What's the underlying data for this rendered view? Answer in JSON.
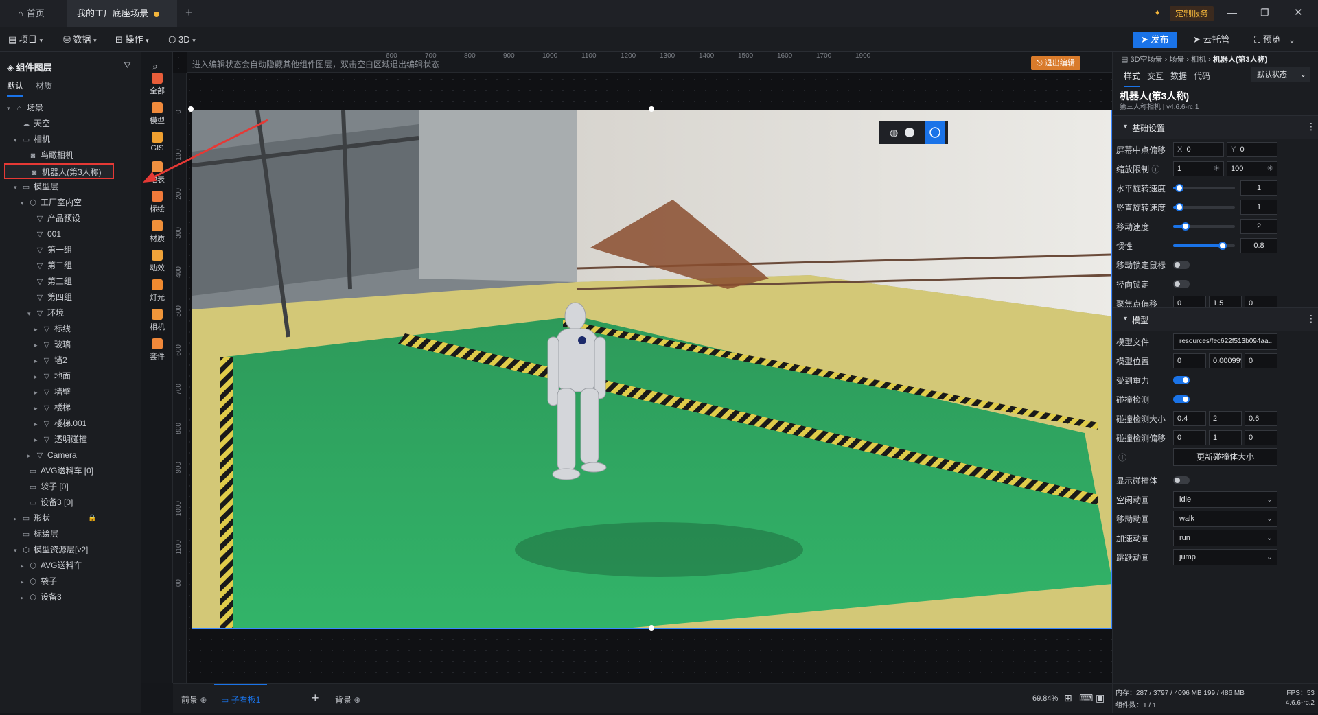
{
  "titlebar": {
    "tabs": [
      {
        "label": "首页"
      },
      {
        "label": "我的工厂底座场景"
      }
    ],
    "new_tab": "+",
    "custom_service": "定制服务"
  },
  "menubar": {
    "items": [
      {
        "label": "项目"
      },
      {
        "label": "数据"
      },
      {
        "label": "操作"
      },
      {
        "label": "3D"
      }
    ],
    "publish": "发布",
    "cloud": "云托管",
    "preview": "预览"
  },
  "left_panel": {
    "title": "组件图层",
    "tabs": [
      "默认",
      "材质"
    ],
    "tree": [
      {
        "label": "场景",
        "level": 0,
        "caret": "▾",
        "icon": "⌂"
      },
      {
        "label": "天空",
        "level": 1,
        "caret": "",
        "icon": "☁"
      },
      {
        "label": "相机",
        "level": 1,
        "caret": "▾",
        "icon": "▭"
      },
      {
        "label": "鸟瞰相机",
        "level": 2,
        "caret": "",
        "icon": "◙"
      },
      {
        "label": "机器人(第3人称)",
        "level": 2,
        "caret": "",
        "icon": "◙"
      },
      {
        "label": "模型层",
        "level": 1,
        "caret": "▾",
        "icon": "▭"
      },
      {
        "label": "工厂室内空",
        "level": 2,
        "caret": "▾",
        "icon": "⬡"
      },
      {
        "label": "产品预设",
        "level": 3,
        "caret": "",
        "icon": "▽"
      },
      {
        "label": "001",
        "level": 3,
        "caret": "",
        "icon": "▽"
      },
      {
        "label": "第一组",
        "level": 3,
        "caret": "",
        "icon": "▽"
      },
      {
        "label": "第二组",
        "level": 3,
        "caret": "",
        "icon": "▽"
      },
      {
        "label": "第三组",
        "level": 3,
        "caret": "",
        "icon": "▽"
      },
      {
        "label": "第四组",
        "level": 3,
        "caret": "",
        "icon": "▽"
      },
      {
        "label": "环境",
        "level": 3,
        "caret": "▾",
        "icon": "▽"
      },
      {
        "label": "标线",
        "level": 4,
        "caret": "▸",
        "icon": "▽"
      },
      {
        "label": "玻璃",
        "level": 4,
        "caret": "▸",
        "icon": "▽"
      },
      {
        "label": "墙2",
        "level": 4,
        "caret": "▸",
        "icon": "▽"
      },
      {
        "label": "地面",
        "level": 4,
        "caret": "▸",
        "icon": "▽"
      },
      {
        "label": "墙壁",
        "level": 4,
        "caret": "▸",
        "icon": "▽"
      },
      {
        "label": "楼梯",
        "level": 4,
        "caret": "▸",
        "icon": "▽"
      },
      {
        "label": "楼梯.001",
        "level": 4,
        "caret": "▸",
        "icon": "▽"
      },
      {
        "label": "透明碰撞",
        "level": 4,
        "caret": "▸",
        "icon": "▽"
      },
      {
        "label": "Camera",
        "level": 3,
        "caret": "▸",
        "icon": "▽"
      },
      {
        "label": "AVG送料车 [0]",
        "level": 2,
        "caret": "",
        "icon": "▭"
      },
      {
        "label": "袋子 [0]",
        "level": 2,
        "caret": "",
        "icon": "▭"
      },
      {
        "label": "设备3 [0]",
        "level": 2,
        "caret": "",
        "icon": "▭"
      },
      {
        "label": "形状",
        "level": 1,
        "caret": "▸",
        "icon": "▭"
      },
      {
        "label": "标绘层",
        "level": 1,
        "caret": "",
        "icon": "▭"
      },
      {
        "label": "模型资源层[v2]",
        "level": 1,
        "caret": "▾",
        "icon": "⬡"
      },
      {
        "label": "AVG送料车",
        "level": 2,
        "caret": "▸",
        "icon": "⬡"
      },
      {
        "label": "袋子",
        "level": 2,
        "caret": "▸",
        "icon": "⬡"
      },
      {
        "label": "设备3",
        "level": 2,
        "caret": "▸",
        "icon": "⬡"
      }
    ]
  },
  "vtools": [
    {
      "label": "全部",
      "color": "#e85d3a"
    },
    {
      "label": "模型",
      "color": "#f08a3c"
    },
    {
      "label": "GIS",
      "color": "#f0a030"
    },
    {
      "label": "地表",
      "color": "#f09040"
    },
    {
      "label": "标绘",
      "color": "#f07a3a"
    },
    {
      "label": "材质",
      "color": "#f0903a"
    },
    {
      "label": "动效",
      "color": "#f0a33a"
    },
    {
      "label": "灯光",
      "color": "#f08a30"
    },
    {
      "label": "相机",
      "color": "#f0963a"
    },
    {
      "label": "套件",
      "color": "#f0883a"
    }
  ],
  "canvas": {
    "hint": "进入编辑状态会自动隐藏其他组件图层，双击空白区域退出编辑状态",
    "exit_edit": "退出编辑",
    "ruler_top": [
      "600",
      "700",
      "800",
      "900",
      "1000",
      "1100",
      "1200",
      "1300",
      "1400",
      "1500",
      "1600",
      "1700",
      "1900"
    ],
    "ruler_left": [
      "0",
      "100",
      "200",
      "300",
      "400",
      "500",
      "600",
      "700",
      "800",
      "900",
      "1000",
      "1100",
      "00"
    ]
  },
  "bottom": {
    "foreground": "前景",
    "subpanel": "子看板1",
    "background": "背景",
    "zoom": "69.84%"
  },
  "right_panel": {
    "breadcrumb": [
      "3D空场景",
      "场景",
      "相机",
      "机器人(第3人称)"
    ],
    "tabs": [
      "样式",
      "交互",
      "数据",
      "代码"
    ],
    "state_select": "默认状态",
    "component_title": "机器人(第3人称)",
    "component_sub": "第三人称相机 | v4.6.6-rc.1",
    "section_basic": "基础设置",
    "screen_offset": {
      "label": "屏幕中点偏移",
      "x_prefix": "X",
      "x": "0",
      "y_prefix": "Y",
      "y": "0"
    },
    "zoom_limit": {
      "label": "缩放限制",
      "min": "1",
      "max": "100"
    },
    "h_rot_speed": {
      "label": "水平旋转速度",
      "value": "1",
      "fraction": 0.1
    },
    "v_rot_speed": {
      "label": "竖直旋转速度",
      "value": "1",
      "fraction": 0.1
    },
    "move_speed": {
      "label": "移动速度",
      "value": "2",
      "fraction": 0.2
    },
    "inertia": {
      "label": "惯性",
      "value": "0.8",
      "fraction": 0.8
    },
    "lock_mouse": {
      "label": "移动锁定鼠标",
      "on": false
    },
    "radial_lock": {
      "label": "径向锁定",
      "on": false
    },
    "focus_offset": {
      "label": "聚焦点偏移",
      "values": [
        "0",
        "1.5",
        "0"
      ]
    },
    "section_model": "模型",
    "model_file": {
      "label": "模型文件",
      "value": "resources/fec622f513b094aa..."
    },
    "model_pos": {
      "label": "模型位置",
      "values": [
        "0",
        "0.0009999",
        "0"
      ]
    },
    "gravity": {
      "label": "受到重力",
      "on": true
    },
    "collision": {
      "label": "碰撞检测",
      "on": true
    },
    "collision_size": {
      "label": "碰撞检测大小",
      "values": [
        "0.4",
        "2",
        "0.6"
      ]
    },
    "collision_offset": {
      "label": "碰撞检测偏移",
      "values": [
        "0",
        "1",
        "0"
      ]
    },
    "update_btn": "更新碰撞体大小",
    "show_collider": {
      "label": "显示碰撞体",
      "on": false
    },
    "idle_anim": {
      "label": "空闲动画",
      "value": "idle"
    },
    "move_anim": {
      "label": "移动动画",
      "value": "walk"
    },
    "accel_anim": {
      "label": "加速动画",
      "value": "run"
    },
    "jump_anim": {
      "label": "跳跃动画",
      "value": "jump"
    },
    "status_mem": "内存：287 / 3797 / 4096 MB 199 / 486 MB",
    "status_fps": "FPS：53",
    "status_count": "组件数：1 / 1",
    "status_version": "4.6.6-rc.2"
  }
}
